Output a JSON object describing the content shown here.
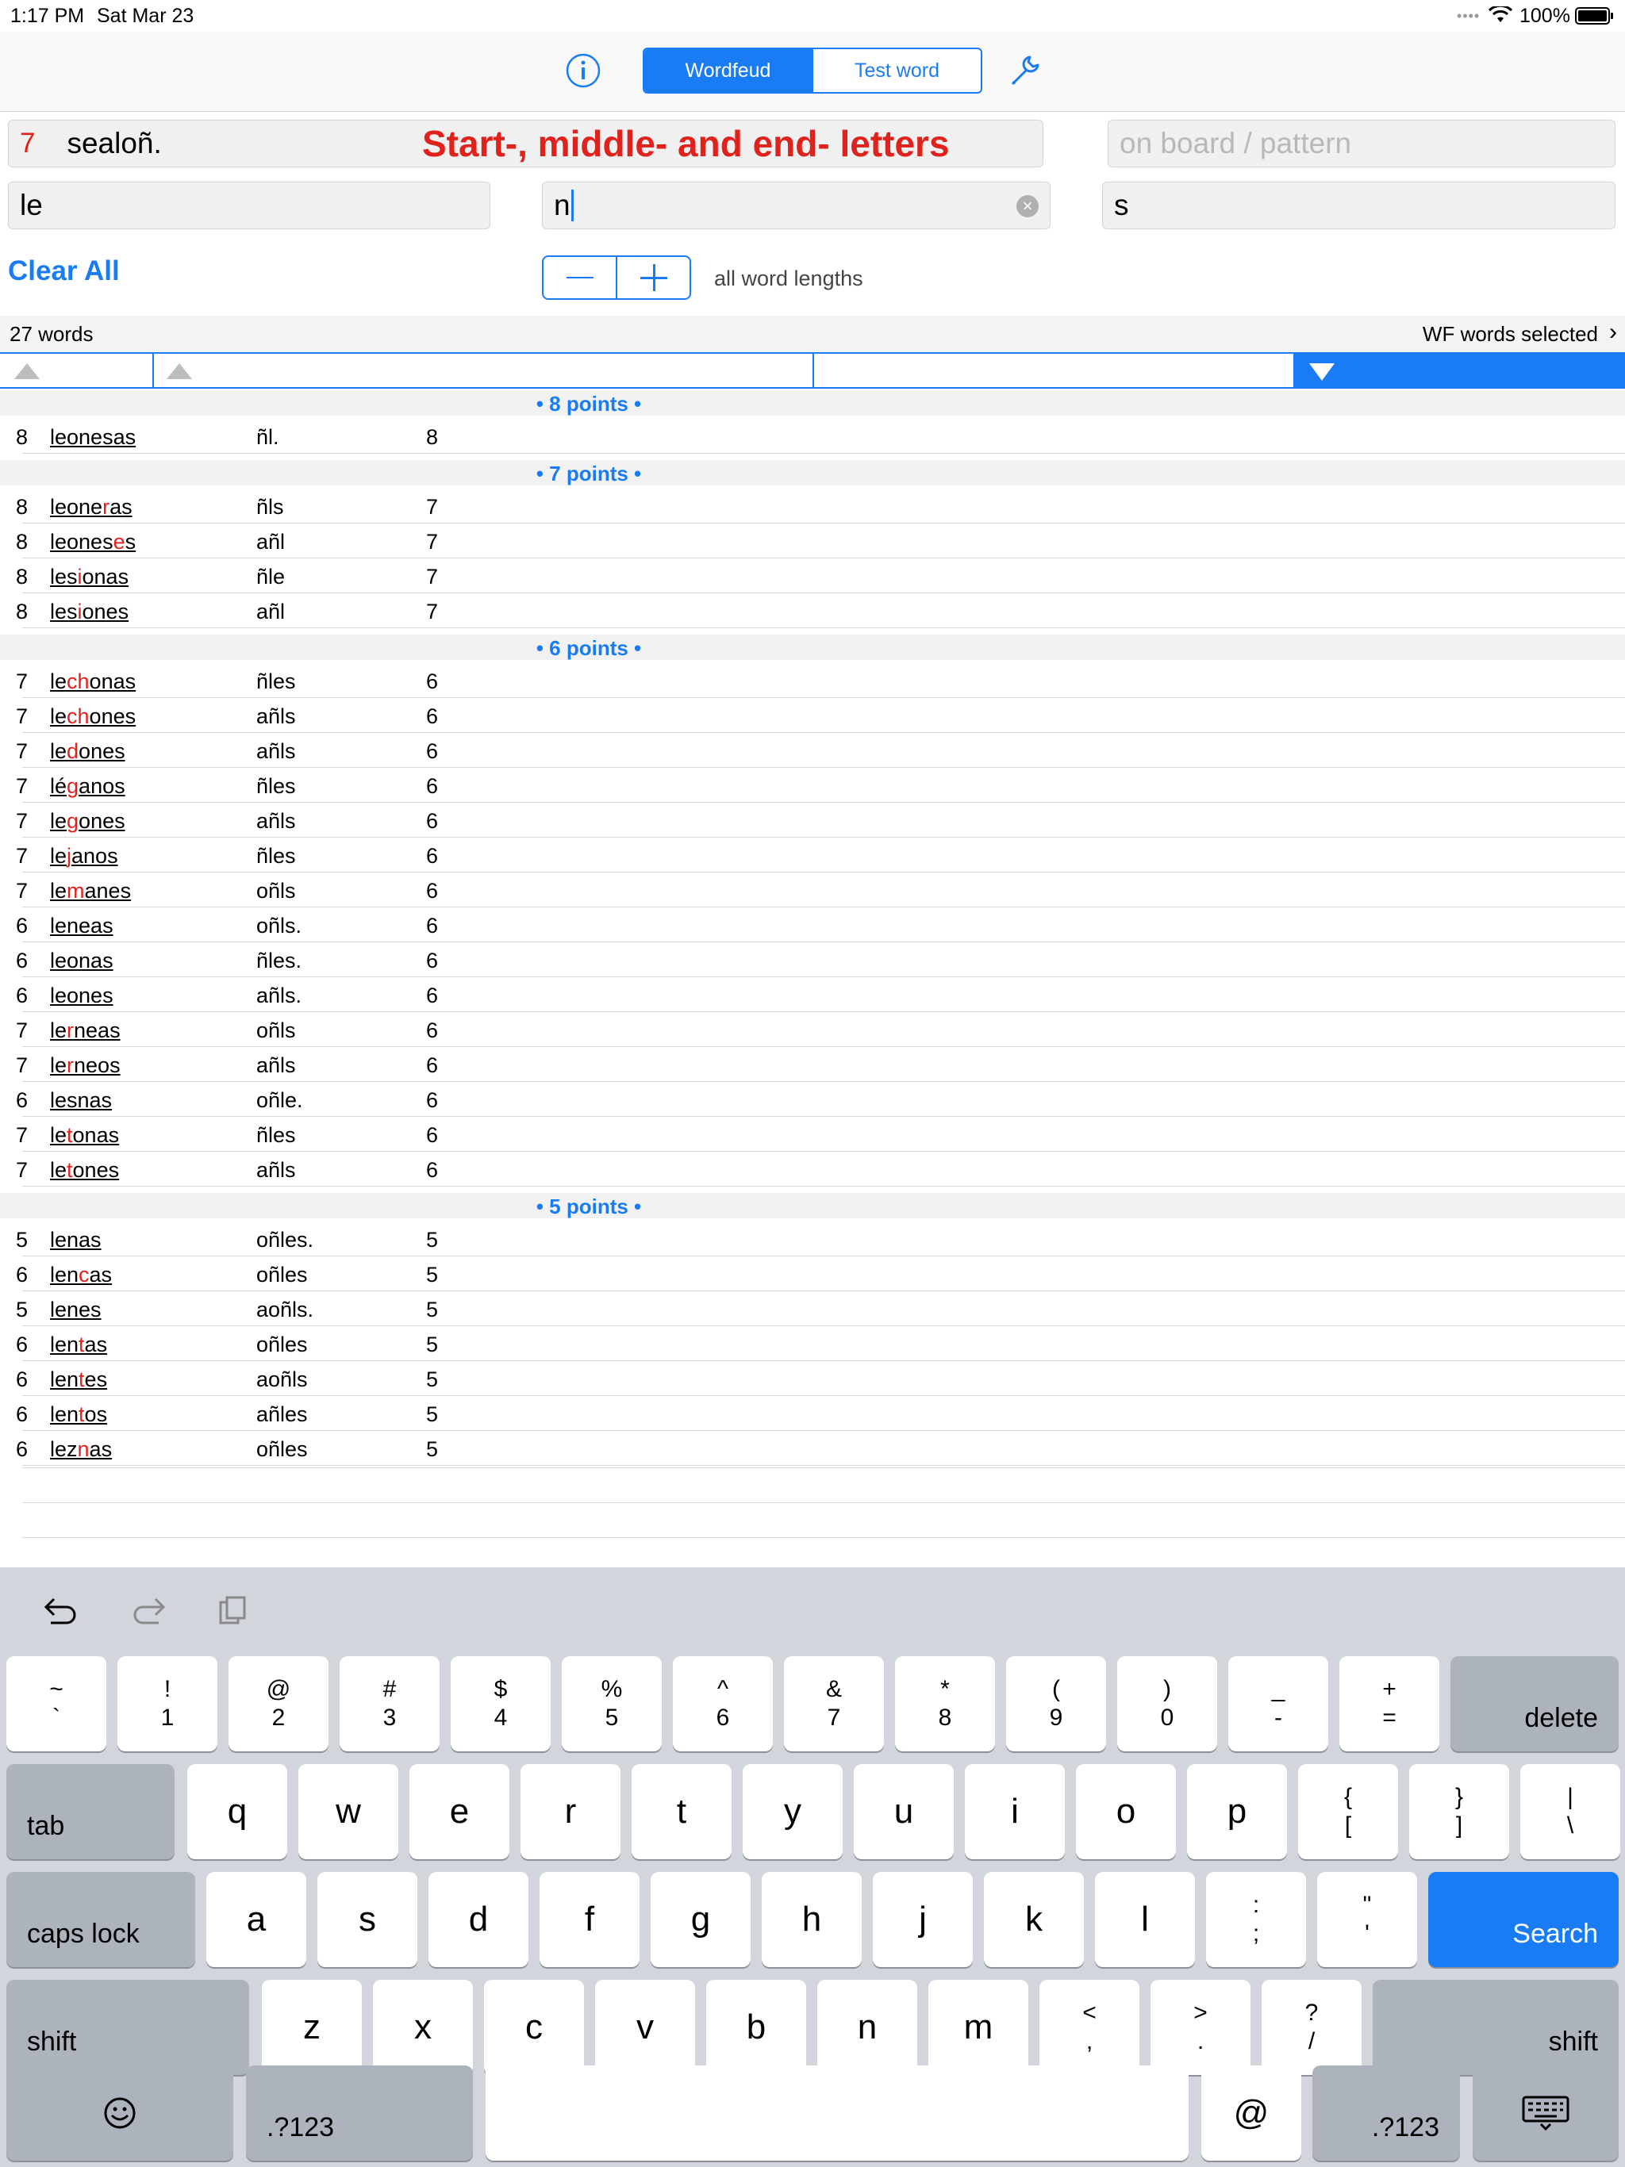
{
  "status": {
    "time": "1:17 PM",
    "date": "Sat Mar 23",
    "battery": "100%"
  },
  "nav": {
    "segments": [
      "Wordfeud",
      "Test word"
    ],
    "info_icon": "info-icon",
    "settings_icon": "wrench-icon"
  },
  "inputs": {
    "count": "7",
    "letters": "sealoñ.",
    "hint": "Start-, middle- and end- letters",
    "pattern_placeholder": "on board / pattern",
    "start": "le",
    "middle": "n",
    "end": "s"
  },
  "controls": {
    "clear_all": "Clear All",
    "lengths": "all word lengths"
  },
  "summary": {
    "count": "27 words",
    "selection": "WF words selected"
  },
  "groups": [
    {
      "label": "• 8 points •",
      "rows": [
        {
          "len": "8",
          "word": [
            [
              "leonesas",
              ""
            ]
          ],
          "rest": "ñl.",
          "pts": "8"
        }
      ]
    },
    {
      "label": "• 7 points •",
      "rows": [
        {
          "len": "8",
          "word": [
            [
              "leone",
              ""
            ],
            [
              "r",
              "r"
            ],
            [
              "as",
              ""
            ]
          ],
          "rest": "ñls",
          "pts": "7"
        },
        {
          "len": "8",
          "word": [
            [
              "leones",
              ""
            ],
            [
              "e",
              "r"
            ],
            [
              "s",
              ""
            ]
          ],
          "rest": "añl",
          "pts": "7"
        },
        {
          "len": "8",
          "word": [
            [
              "les",
              ""
            ],
            [
              "i",
              "r"
            ],
            [
              "onas",
              ""
            ]
          ],
          "rest": "ñle",
          "pts": "7"
        },
        {
          "len": "8",
          "word": [
            [
              "les",
              ""
            ],
            [
              "i",
              "r"
            ],
            [
              "ones",
              ""
            ]
          ],
          "rest": "añl",
          "pts": "7"
        }
      ]
    },
    {
      "label": "• 6 points •",
      "rows": [
        {
          "len": "7",
          "word": [
            [
              "le",
              ""
            ],
            [
              "ch",
              "r"
            ],
            [
              "onas",
              ""
            ]
          ],
          "rest": "ñles",
          "pts": "6"
        },
        {
          "len": "7",
          "word": [
            [
              "le",
              ""
            ],
            [
              "ch",
              "r"
            ],
            [
              "ones",
              ""
            ]
          ],
          "rest": "añls",
          "pts": "6"
        },
        {
          "len": "7",
          "word": [
            [
              "le",
              ""
            ],
            [
              "d",
              "r"
            ],
            [
              "ones",
              ""
            ]
          ],
          "rest": "añls",
          "pts": "6"
        },
        {
          "len": "7",
          "word": [
            [
              "lé",
              ""
            ],
            [
              "g",
              "r"
            ],
            [
              "anos",
              ""
            ]
          ],
          "rest": "ñles",
          "pts": "6"
        },
        {
          "len": "7",
          "word": [
            [
              "le",
              ""
            ],
            [
              "g",
              "r"
            ],
            [
              "ones",
              ""
            ]
          ],
          "rest": "añls",
          "pts": "6"
        },
        {
          "len": "7",
          "word": [
            [
              "le",
              ""
            ],
            [
              "j",
              "r"
            ],
            [
              "anos",
              ""
            ]
          ],
          "rest": "ñles",
          "pts": "6"
        },
        {
          "len": "7",
          "word": [
            [
              "le",
              ""
            ],
            [
              "m",
              "r"
            ],
            [
              "anes",
              ""
            ]
          ],
          "rest": "oñls",
          "pts": "6"
        },
        {
          "len": "6",
          "word": [
            [
              "leneas",
              ""
            ]
          ],
          "rest": "oñls.",
          "pts": "6"
        },
        {
          "len": "6",
          "word": [
            [
              "leonas",
              ""
            ]
          ],
          "rest": "ñles.",
          "pts": "6"
        },
        {
          "len": "6",
          "word": [
            [
              "leones",
              ""
            ]
          ],
          "rest": "añls.",
          "pts": "6"
        },
        {
          "len": "7",
          "word": [
            [
              "le",
              ""
            ],
            [
              "r",
              "r"
            ],
            [
              "neas",
              ""
            ]
          ],
          "rest": "oñls",
          "pts": "6"
        },
        {
          "len": "7",
          "word": [
            [
              "le",
              ""
            ],
            [
              "r",
              "r"
            ],
            [
              "neos",
              ""
            ]
          ],
          "rest": "añls",
          "pts": "6"
        },
        {
          "len": "6",
          "word": [
            [
              "lesnas",
              ""
            ]
          ],
          "rest": "oñle.",
          "pts": "6"
        },
        {
          "len": "7",
          "word": [
            [
              "le",
              ""
            ],
            [
              "t",
              "r"
            ],
            [
              "onas",
              ""
            ]
          ],
          "rest": "ñles",
          "pts": "6"
        },
        {
          "len": "7",
          "word": [
            [
              "le",
              ""
            ],
            [
              "t",
              "r"
            ],
            [
              "ones",
              ""
            ]
          ],
          "rest": "añls",
          "pts": "6"
        }
      ]
    },
    {
      "label": "• 5 points •",
      "rows": [
        {
          "len": "5",
          "word": [
            [
              "lenas",
              ""
            ]
          ],
          "rest": "oñles.",
          "pts": "5"
        },
        {
          "len": "6",
          "word": [
            [
              "len",
              ""
            ],
            [
              "c",
              "r"
            ],
            [
              "as",
              ""
            ]
          ],
          "rest": "oñles",
          "pts": "5"
        },
        {
          "len": "5",
          "word": [
            [
              "lenes",
              ""
            ]
          ],
          "rest": "aoñls.",
          "pts": "5"
        },
        {
          "len": "6",
          "word": [
            [
              "len",
              ""
            ],
            [
              "t",
              "r"
            ],
            [
              "as",
              ""
            ]
          ],
          "rest": "oñles",
          "pts": "5"
        },
        {
          "len": "6",
          "word": [
            [
              "len",
              ""
            ],
            [
              "t",
              "r"
            ],
            [
              "es",
              ""
            ]
          ],
          "rest": "aoñls",
          "pts": "5"
        },
        {
          "len": "6",
          "word": [
            [
              "len",
              ""
            ],
            [
              "t",
              "r"
            ],
            [
              "os",
              ""
            ]
          ],
          "rest": "añles",
          "pts": "5"
        },
        {
          "len": "6",
          "word": [
            [
              "lez",
              ""
            ],
            [
              "n",
              "r"
            ],
            [
              "as",
              ""
            ]
          ],
          "rest": "oñles",
          "pts": "5"
        }
      ]
    }
  ],
  "keyboard": {
    "row1": [
      [
        "~",
        "`"
      ],
      [
        "!",
        "1"
      ],
      [
        "@",
        "2"
      ],
      [
        "#",
        "3"
      ],
      [
        "$",
        "4"
      ],
      [
        "%",
        "5"
      ],
      [
        "^",
        "6"
      ],
      [
        "&",
        "7"
      ],
      [
        "*",
        "8"
      ],
      [
        "(",
        "9"
      ],
      [
        ")",
        "0"
      ],
      [
        "_",
        "-"
      ],
      [
        "+",
        "="
      ]
    ],
    "delete": "delete",
    "tab": "tab",
    "row2": [
      "q",
      "w",
      "e",
      "r",
      "t",
      "y",
      "u",
      "i",
      "o",
      "p"
    ],
    "row2_sym": [
      [
        "{",
        "["
      ],
      [
        "}",
        "]"
      ],
      [
        "|",
        "\\"
      ]
    ],
    "caps": "caps lock",
    "row3": [
      "a",
      "s",
      "d",
      "f",
      "g",
      "h",
      "j",
      "k",
      "l"
    ],
    "row3_sym": [
      [
        ":",
        ";"
      ],
      [
        "\"",
        "'"
      ]
    ],
    "search": "Search",
    "shift": "shift",
    "row4": [
      "z",
      "x",
      "c",
      "v",
      "b",
      "n",
      "m"
    ],
    "row4_sym": [
      [
        "<",
        ","
      ],
      [
        ">",
        "."
      ],
      [
        "?",
        "/"
      ]
    ],
    "numsym": ".?123",
    "at": "@"
  },
  "colors": {
    "accent": "#1a7cf5",
    "highlight": "#e0221d"
  }
}
